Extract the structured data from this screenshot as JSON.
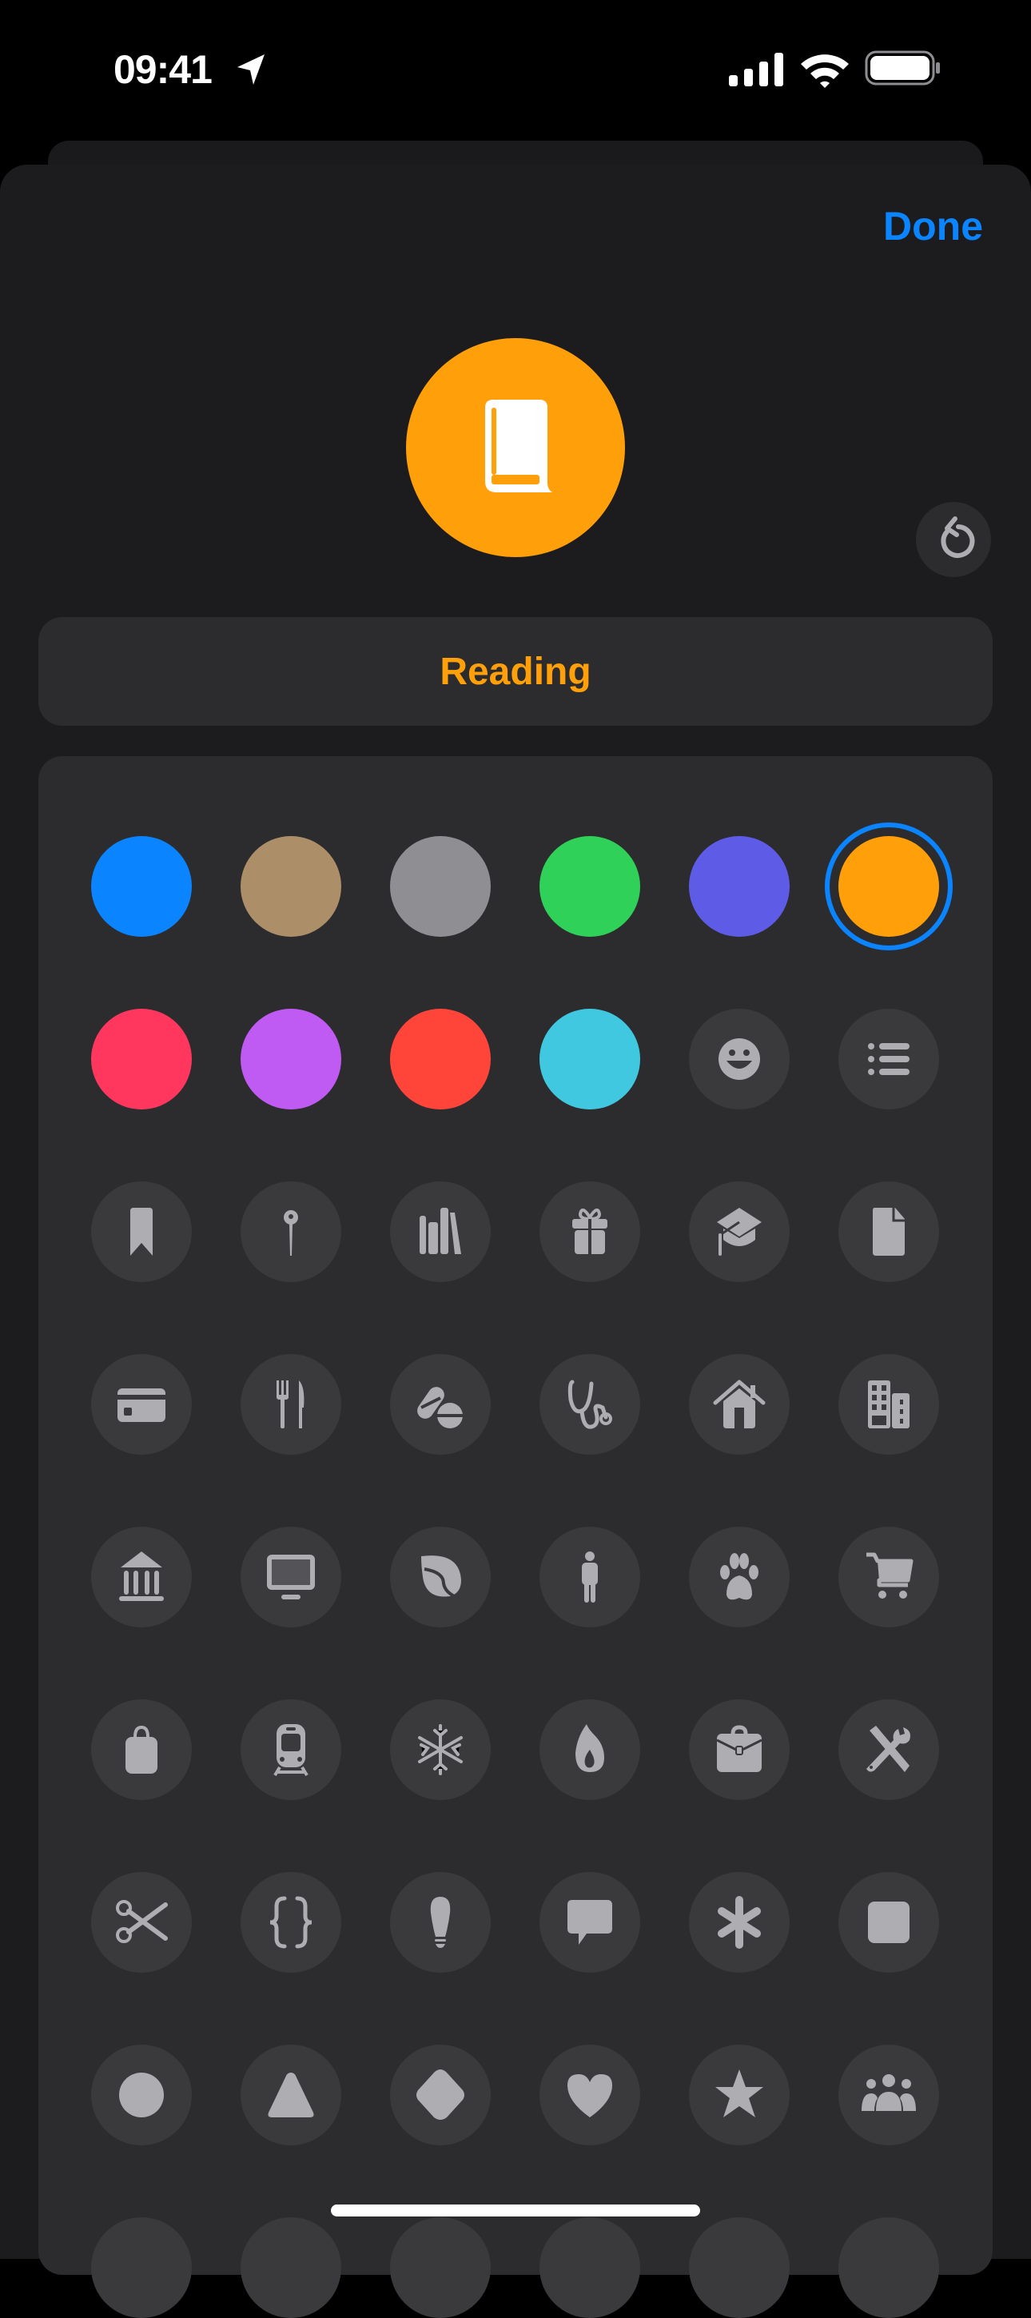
{
  "status_bar": {
    "time": "09:41"
  },
  "sheet": {
    "done_label": "Done",
    "list_name": "Reading",
    "accent_color": "#ff9f0a",
    "link_color": "#0a84ff",
    "preview_icon": "book-icon"
  },
  "colors": [
    {
      "name": "blue",
      "hex": "#0a84ff"
    },
    {
      "name": "brown",
      "hex": "#ac8e68"
    },
    {
      "name": "gray",
      "hex": "#8e8e93"
    },
    {
      "name": "green",
      "hex": "#30d158"
    },
    {
      "name": "indigo",
      "hex": "#5e5ce6"
    },
    {
      "name": "orange",
      "hex": "#ff9f0a",
      "selected": true
    },
    {
      "name": "pink",
      "hex": "#ff375f"
    },
    {
      "name": "purple",
      "hex": "#bf5af2"
    },
    {
      "name": "red",
      "hex": "#ff453a"
    },
    {
      "name": "cyan",
      "hex": "#40c8e0"
    }
  ],
  "icons": [
    "smiley-icon",
    "list-icon",
    "bookmark-icon",
    "pin-icon",
    "books-icon",
    "gift-icon",
    "graduation-cap-icon",
    "document-icon",
    "credit-card-icon",
    "fork-knife-icon",
    "pills-icon",
    "stethoscope-icon",
    "house-icon",
    "building-icon",
    "bank-icon",
    "desktop-icon",
    "leaf-icon",
    "person-icon",
    "paw-icon",
    "cart-icon",
    "bag-icon",
    "tram-icon",
    "snowflake-icon",
    "flame-icon",
    "briefcase-icon",
    "tools-icon",
    "scissors-icon",
    "braces-icon",
    "lightbulb-icon",
    "speech-bubble-icon",
    "asterisk-icon",
    "square-icon",
    "circle-icon",
    "triangle-icon",
    "diamond-icon",
    "heart-icon",
    "star-icon",
    "group-icon"
  ]
}
